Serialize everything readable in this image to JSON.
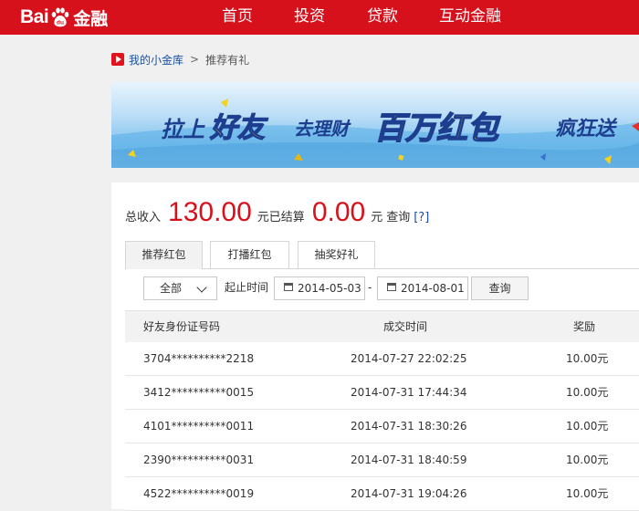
{
  "header": {
    "logo_left": "Bai",
    "logo_paw_text": "du",
    "logo_right": "金融",
    "nav": [
      "首页",
      "投资",
      "贷款",
      "互动金融"
    ]
  },
  "breadcrumb": {
    "home": "我的小金库",
    "separator": ">",
    "current": "推荐有礼"
  },
  "banner": {
    "part1": "拉上",
    "part2": "好友",
    "part3": "去理财",
    "part4": "百万红包",
    "part5": "疯狂送"
  },
  "summary": {
    "total_label": "总收入",
    "total_value": "130.00",
    "unit1": "元",
    "settled_label": "已结算",
    "settled_value": "0.00",
    "unit2": "元",
    "query_label": "查询",
    "help": "[?]"
  },
  "tabs": [
    "推荐红包",
    "打播红包",
    "抽奖好礼"
  ],
  "filters": {
    "select_value": "全部",
    "time_label": "起止时间",
    "start_date": "2014-05-03",
    "dash": "-",
    "end_date": "2014-08-01",
    "query_button": "查询"
  },
  "table": {
    "headers": [
      "好友身份证号码",
      "成交时间",
      "奖励"
    ],
    "rows": [
      [
        "3704**********2218",
        "2014-07-27 22:02:25",
        "10.00元"
      ],
      [
        "3412**********0015",
        "2014-07-31 17:44:34",
        "10.00元"
      ],
      [
        "4101**********0011",
        "2014-07-31 18:30:26",
        "10.00元"
      ],
      [
        "2390**********0031",
        "2014-07-31 18:40:59",
        "10.00元"
      ],
      [
        "4522**********0019",
        "2014-07-31 19:04:26",
        "10.00元"
      ]
    ]
  },
  "colors": {
    "brand_red": "#d6111c",
    "link_blue": "#1a4fa0",
    "banner_blue": "#1d3d8f",
    "banner_yellow": "#f6d21a"
  }
}
